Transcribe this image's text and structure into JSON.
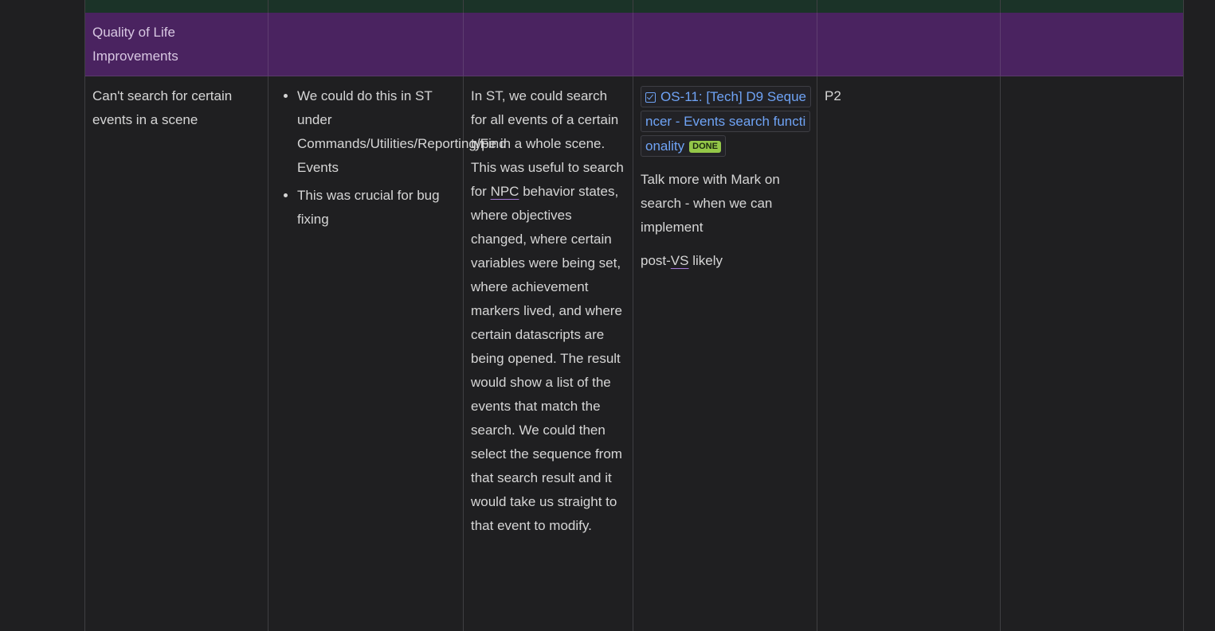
{
  "group_header": {
    "title": "Quality of Life Improvements"
  },
  "row": {
    "issue": "Can't search for certain events in a scene",
    "bullets": [
      "We could do this in ST under Commands/Utilities/Reporting/Find Events",
      "This was crucial for bug fixing"
    ],
    "description": {
      "before": "In ST, we could search for all events of a certain type in a whole scene. This was useful to search for ",
      "abbr": "NPC",
      "after": " behavior states, where objectives changed, where certain variables were being set, where achievement markers lived, and where certain datascripts are being opened. The result would show a list of the events that match the search. We could then select the sequence from that search result and it would take us straight to that event to modify."
    },
    "ticket": {
      "icon": "checkbox-icon",
      "label": "OS-11: [Tech] D9 Sequencer - Events search functionality",
      "status": "DONE",
      "status_color": "#94c748"
    },
    "notes": {
      "line1": "Talk more with Mark on search - when we can implement",
      "line2_before": "post-",
      "line2_abbr": "VS",
      "line2_after": " likely"
    },
    "priority": "P2"
  },
  "colors": {
    "background": "#1f1f21",
    "group_row": "#4a2360",
    "top_row": "#1b3328",
    "link": "#6fa3f5"
  }
}
